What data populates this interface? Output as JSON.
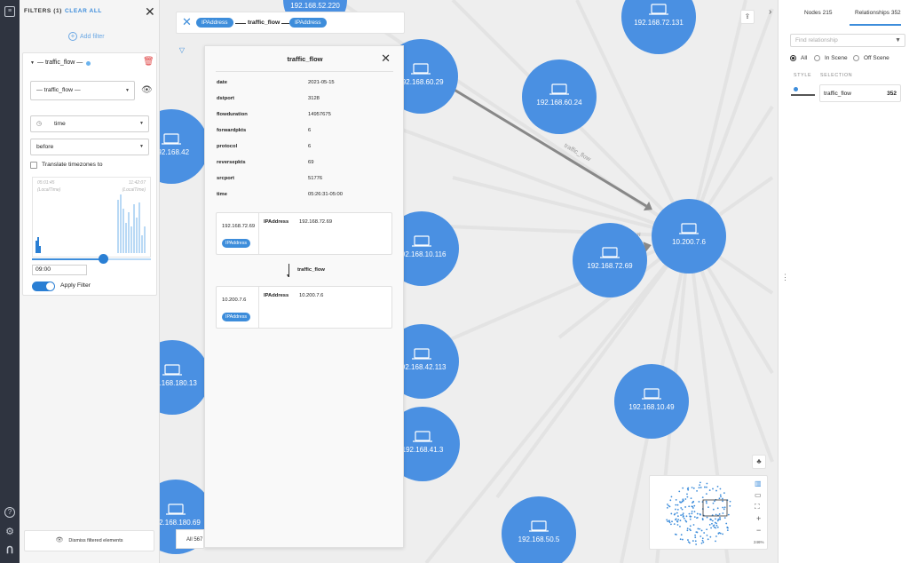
{
  "filters": {
    "header": "FILTERS (1)",
    "clear_all": "CLEAR ALL",
    "add_filter": "Add filter",
    "relationship_type": "— traffic_flow —",
    "card_title": "— traffic_flow —",
    "property": "time",
    "operator": "before",
    "translate_timezones": "Translate timezones to",
    "hist_start": "05:01:45",
    "hist_end": "11:42:07",
    "hist_start_sub": "(LocalTime)",
    "hist_end_sub": "(LocalTime)",
    "time_value": "09:00",
    "apply_filter": "Apply Filter",
    "dismiss": "Dismiss filtered elements",
    "slider_fraction": 0.6
  },
  "pathbar": {
    "from": "IPAddress",
    "rel": "traffic_flow",
    "to": "IPAddress"
  },
  "detail": {
    "title": "traffic_flow",
    "props": [
      {
        "k": "date",
        "v": "2021-05-15"
      },
      {
        "k": "dstport",
        "v": "3128"
      },
      {
        "k": "flowduration",
        "v": "14957675"
      },
      {
        "k": "forwardpkts",
        "v": "6"
      },
      {
        "k": "protocol",
        "v": "6"
      },
      {
        "k": "reversepkts",
        "v": "69"
      },
      {
        "k": "srcport",
        "v": "51776"
      },
      {
        "k": "time",
        "v": "05:26:31-05:00"
      }
    ],
    "source": {
      "ip": "192.168.72.69",
      "label": "IPAddress",
      "prop_key": "IPAddress",
      "prop_val": "192.168.72.69"
    },
    "rel_label": "traffic_flow",
    "target": {
      "ip": "10.200.7.6",
      "label": "IPAddress",
      "prop_key": "IPAddress",
      "prop_val": "10.200.7.6"
    }
  },
  "all_label": "All 567",
  "right_panel": {
    "tab_nodes": "Nodes 215",
    "tab_relationships": "Relationships 352",
    "search_placeholder": "Find relationship",
    "radio_all": "All",
    "radio_in_scene": "In Scene",
    "radio_off_scene": "Off Scene",
    "col_style": "STYLE",
    "col_selection": "SELECTION",
    "rel_name": "traffic_flow",
    "rel_count": "352"
  },
  "graph": {
    "nodes": [
      "192.168.52.220",
      "192.168.72.131",
      "192.168.60.29",
      "192.168.60.24",
      "192.168.42",
      "10.200.7.6",
      "192.168.10.116",
      "192.168.72.69",
      "192.168.180.13",
      "192.168.42.113",
      "192.168.10.49",
      "192.168.41.3",
      "192.168.180.69",
      "192.168.50.5"
    ],
    "edge_label": "traffic_flow"
  },
  "minimap": {
    "zoom": "246%"
  },
  "colors": {
    "node": "#4a90e2",
    "accent": "#3d8ddb",
    "rail": "#2f3440"
  }
}
